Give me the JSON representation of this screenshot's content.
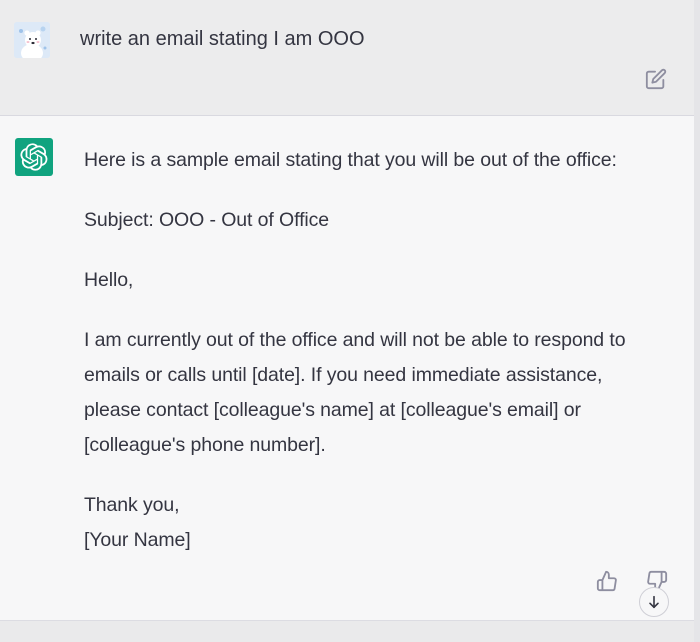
{
  "user_message": {
    "avatar": "polar-bear-avatar",
    "text": "write an email stating I am OOO",
    "edit_icon": "edit-icon"
  },
  "assistant_message": {
    "avatar": "chatgpt-logo-icon",
    "intro": "Here is a sample email stating that you will be out of the office:",
    "subject": "Subject: OOO - Out of Office",
    "greeting": "Hello,",
    "body_lines": [
      "I am currently out of the office and will not be able to respond to",
      "emails or calls until [date]. If you need immediate assistance,",
      "please contact [colleague's name] at [colleague's email] or",
      "[colleague's phone number]."
    ],
    "closing": "Thank you,",
    "signature": "[Your Name]",
    "feedback_icons": [
      "thumbs-up-icon",
      "thumbs-down-icon"
    ]
  },
  "controls": {
    "scroll_down_icon": "arrow-down-icon"
  },
  "colors": {
    "user_row_bg": "#ececed",
    "assistant_row_bg": "#f7f7f8",
    "logo_green": "#10a37f",
    "text": "#343541",
    "icon_gray": "#8e8ea0"
  }
}
